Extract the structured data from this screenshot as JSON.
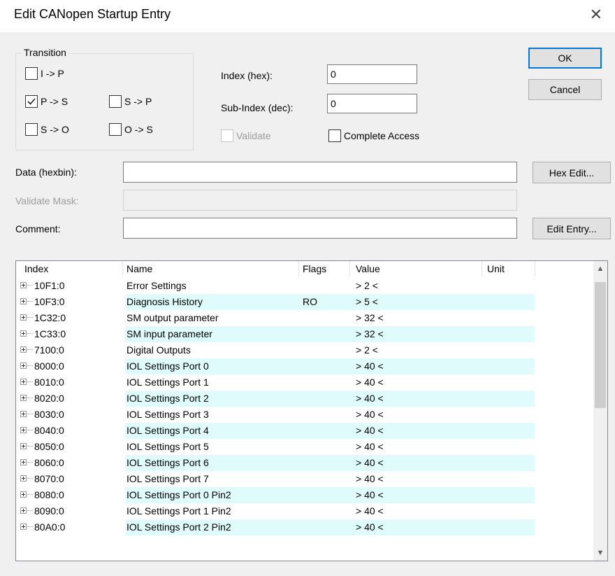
{
  "window": {
    "title": "Edit CANopen Startup Entry",
    "close_glyph": "✕"
  },
  "transition": {
    "title": "Transition",
    "items": [
      {
        "label": "I -> P",
        "checked": false
      },
      {
        "label": "P -> S",
        "checked": true
      },
      {
        "label": "S -> P",
        "checked": false
      },
      {
        "label": "S -> O",
        "checked": false
      },
      {
        "label": "O -> S",
        "checked": false
      }
    ]
  },
  "fields": {
    "index_label": "Index (hex):",
    "index_value": "0",
    "subindex_label": "Sub-Index (dec):",
    "subindex_value": "0",
    "validate_label": "Validate",
    "complete_access_label": "Complete Access",
    "data_label": "Data (hexbin):",
    "data_value": "",
    "validate_mask_label": "Validate Mask:",
    "validate_mask_value": "",
    "comment_label": "Comment:",
    "comment_value": ""
  },
  "buttons": {
    "ok": "OK",
    "cancel": "Cancel",
    "hex_edit": "Hex Edit...",
    "edit_entry": "Edit Entry..."
  },
  "table": {
    "columns": [
      "Index",
      "Name",
      "Flags",
      "Value",
      "Unit"
    ],
    "rows": [
      {
        "index": "10F1:0",
        "name": "Error Settings",
        "flags": "",
        "value": "> 2 <",
        "unit": ""
      },
      {
        "index": "10F3:0",
        "name": "Diagnosis History",
        "flags": "RO",
        "value": "> 5 <",
        "unit": ""
      },
      {
        "index": "1C32:0",
        "name": "SM output parameter",
        "flags": "",
        "value": "> 32 <",
        "unit": ""
      },
      {
        "index": "1C33:0",
        "name": "SM input parameter",
        "flags": "",
        "value": "> 32 <",
        "unit": ""
      },
      {
        "index": "7100:0",
        "name": "Digital Outputs",
        "flags": "",
        "value": "> 2 <",
        "unit": ""
      },
      {
        "index": "8000:0",
        "name": "IOL Settings Port 0",
        "flags": "",
        "value": "> 40 <",
        "unit": ""
      },
      {
        "index": "8010:0",
        "name": "IOL Settings Port 1",
        "flags": "",
        "value": "> 40 <",
        "unit": ""
      },
      {
        "index": "8020:0",
        "name": "IOL Settings Port 2",
        "flags": "",
        "value": "> 40 <",
        "unit": ""
      },
      {
        "index": "8030:0",
        "name": "IOL Settings Port 3",
        "flags": "",
        "value": "> 40 <",
        "unit": ""
      },
      {
        "index": "8040:0",
        "name": "IOL Settings Port 4",
        "flags": "",
        "value": "> 40 <",
        "unit": ""
      },
      {
        "index": "8050:0",
        "name": "IOL Settings Port 5",
        "flags": "",
        "value": "> 40 <",
        "unit": ""
      },
      {
        "index": "8060:0",
        "name": "IOL Settings Port 6",
        "flags": "",
        "value": "> 40 <",
        "unit": ""
      },
      {
        "index": "8070:0",
        "name": "IOL Settings Port 7",
        "flags": "",
        "value": "> 40 <",
        "unit": ""
      },
      {
        "index": "8080:0",
        "name": "IOL Settings Port 0 Pin2",
        "flags": "",
        "value": "> 40 <",
        "unit": ""
      },
      {
        "index": "8090:0",
        "name": "IOL Settings Port 1 Pin2",
        "flags": "",
        "value": "> 40 <",
        "unit": ""
      },
      {
        "index": "80A0:0",
        "name": "IOL Settings Port 2 Pin2",
        "flags": "",
        "value": "> 40 <",
        "unit": ""
      }
    ]
  },
  "colors": {
    "row_alt_bg": "#e0fbfb",
    "default_button_border": "#0078d7"
  }
}
